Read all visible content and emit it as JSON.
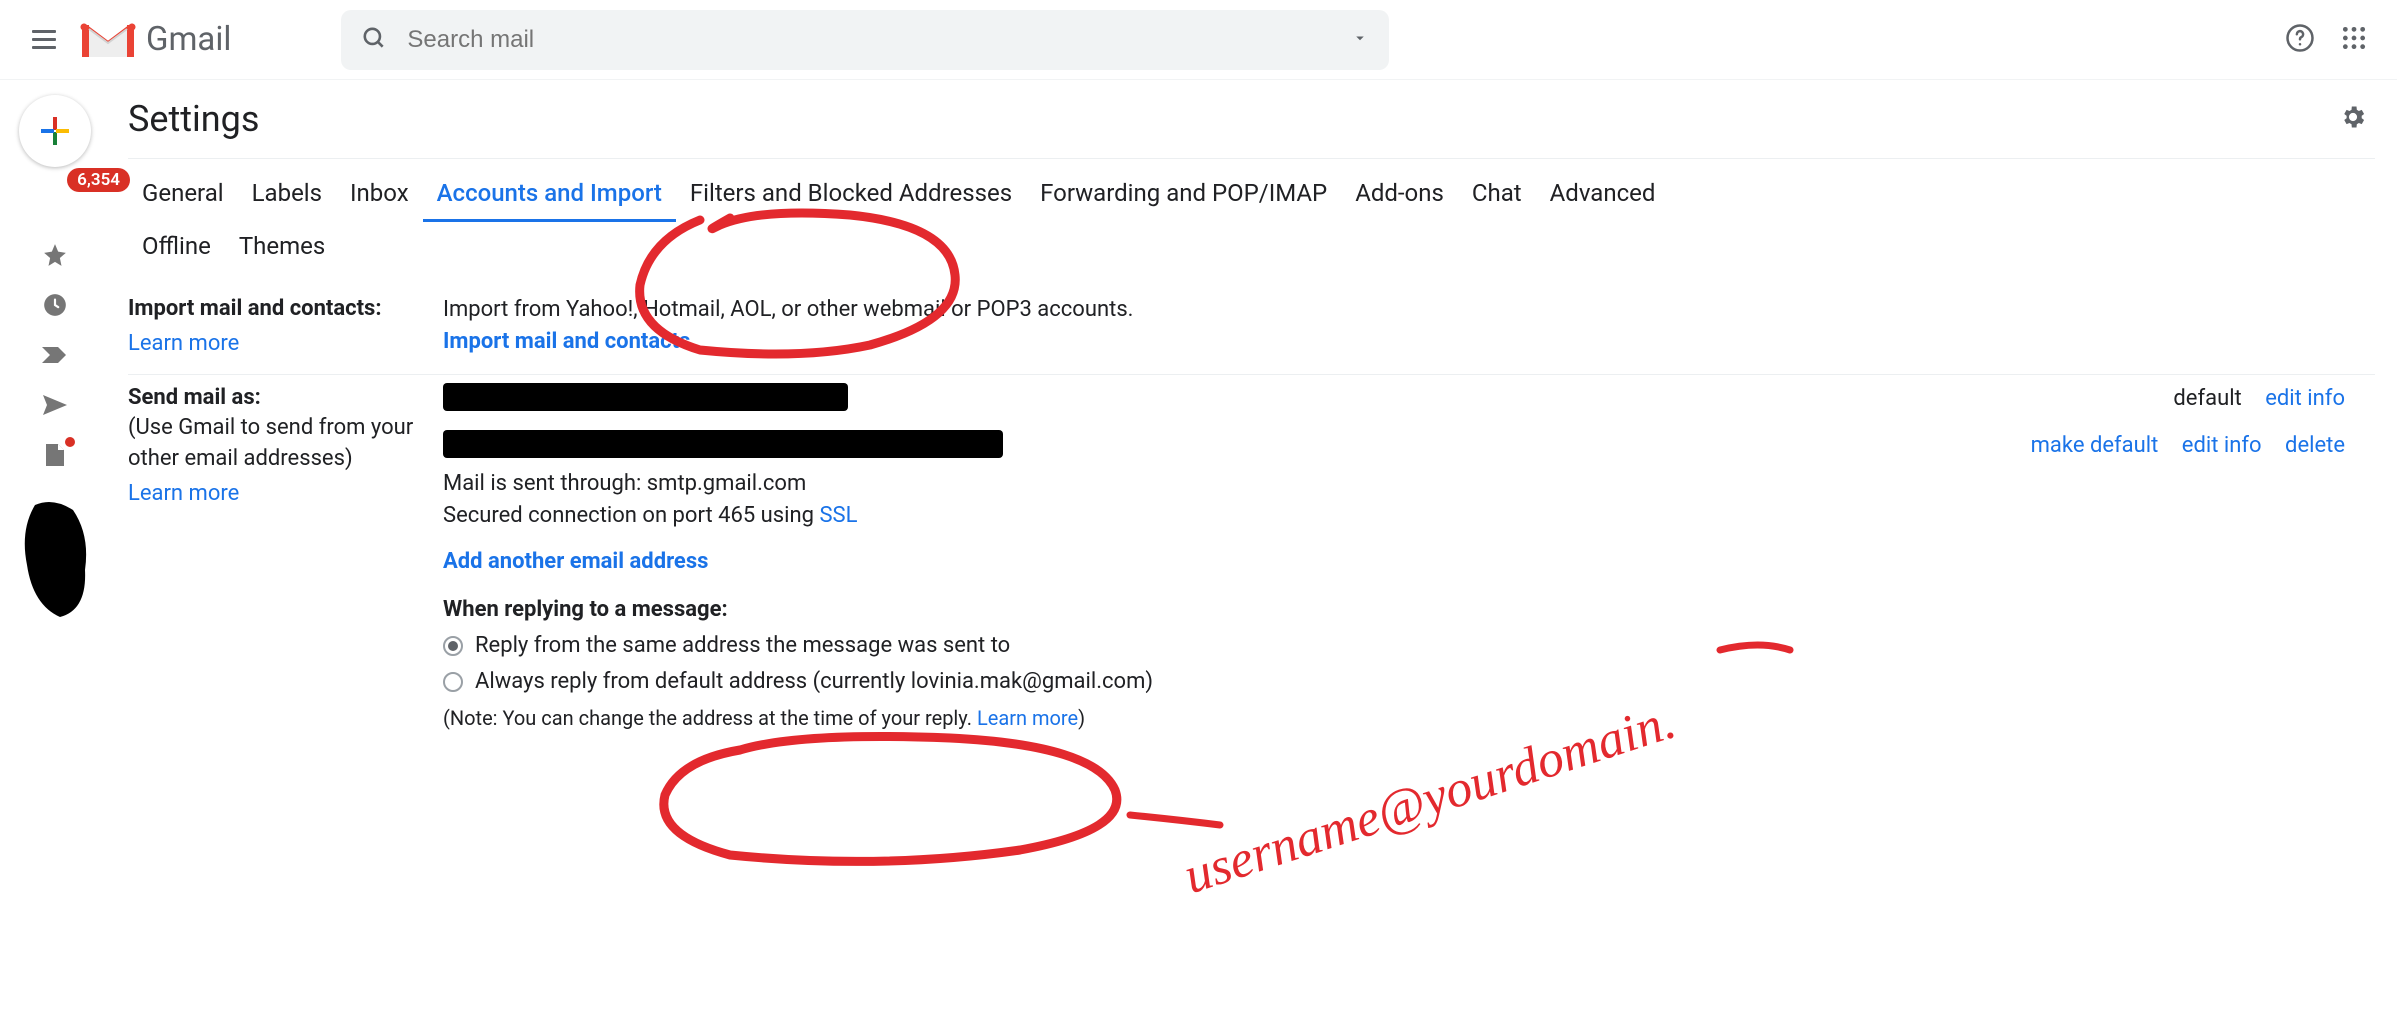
{
  "header": {
    "app_name": "Gmail",
    "search_placeholder": "Search mail"
  },
  "sidebar": {
    "badge_count": "6,354"
  },
  "page": {
    "title": "Settings"
  },
  "tabs": [
    {
      "label": "General"
    },
    {
      "label": "Labels"
    },
    {
      "label": "Inbox"
    },
    {
      "label": "Accounts and Import"
    },
    {
      "label": "Filters and Blocked Addresses"
    },
    {
      "label": "Forwarding and POP/IMAP"
    },
    {
      "label": "Add-ons"
    },
    {
      "label": "Chat"
    },
    {
      "label": "Advanced"
    },
    {
      "label": "Offline"
    },
    {
      "label": "Themes"
    }
  ],
  "active_tab_index": 3,
  "import_section": {
    "title": "Import mail and contacts:",
    "learn_more": "Learn more",
    "desc": "Import from Yahoo!, Hotmail, AOL, or other webmail or POP3 accounts.",
    "action": "Import mail and contacts"
  },
  "send_as_section": {
    "title": "Send mail as:",
    "sub": "(Use Gmail to send from your other email addresses)",
    "learn_more": "Learn more",
    "row1": {
      "status": "default",
      "edit": "edit info"
    },
    "row2": {
      "sent_through": "Mail is sent through: smtp.gmail.com",
      "secured_pre": "Secured connection on port 465 using ",
      "secured_link": "SSL",
      "make_default": "make default",
      "edit": "edit info",
      "delete": "delete"
    },
    "add_another": "Add another email address",
    "reply": {
      "heading": "When replying to a message:",
      "opt1": "Reply from the same address the message was sent to",
      "opt2": "Always reply from default address (currently lovinia.mak@gmail.com)",
      "note_pre": "(Note: You can change the address at the time of your reply. ",
      "note_link": "Learn more",
      "note_post": ")"
    }
  },
  "annotation": {
    "handwriting": "username@yourdomain."
  }
}
